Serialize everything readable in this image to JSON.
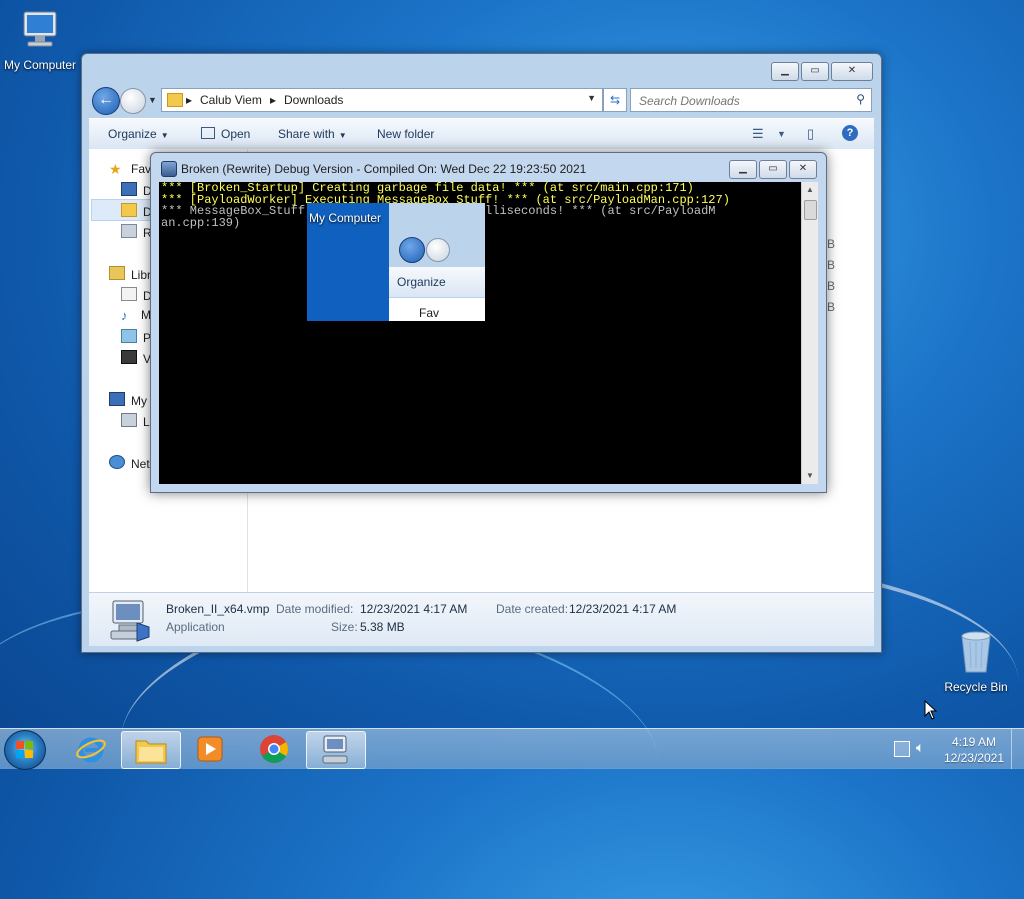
{
  "desktop": {
    "icons": [
      {
        "label": "My Computer"
      },
      {
        "label": "Recycle Bin"
      }
    ]
  },
  "explorer": {
    "address": {
      "crumbs": [
        "Calub Viem",
        "Downloads"
      ]
    },
    "search": {
      "placeholder": "Search Downloads"
    },
    "toolbar": {
      "organize": "Organize",
      "open": "Open",
      "share_with": "Share with",
      "new_folder": "New folder"
    },
    "nav": {
      "items": [
        "Fav",
        "De",
        "Do",
        "Re",
        "Libr",
        "Do",
        "M",
        "Pi",
        "Vi",
        "My",
        "Lo",
        "Net"
      ]
    },
    "size_fragments": [
      "B",
      "B",
      "B",
      "B"
    ],
    "details": {
      "filename": "Broken_II_x64.vmp",
      "type": "Application",
      "date_modified_label": "Date modified:",
      "date_modified": "12/23/2021 4:17 AM",
      "date_created_label": "Date created:",
      "date_created": "12/23/2021 4:17 AM",
      "size_label": "Size:",
      "size": "5.38 MB"
    }
  },
  "console": {
    "title": "Broken (Rewrite) Debug Version - Compiled On: Wed Dec 22 19:23:50 2021",
    "lines": [
      "*** [Broken_Startup] Creating garbage file data! *** (at src/main.cpp:171)",
      "*** [PayloadWorker] Executing MessageBox_Stuff! *** (at src/PayloadMan.cpp:127)",
      "*** MessageBox_Stuff thread s         6534 milliseconds! *** (at src/PayloadM",
      "an.cpp:139)"
    ],
    "glitch": {
      "desktop_label": "My Computer",
      "organize": "Organize",
      "fav": "Fav"
    }
  },
  "taskbar": {
    "apps": [
      "start",
      "internet-explorer",
      "windows-explorer",
      "media-player",
      "chrome",
      "broken-app"
    ],
    "active": "windows-explorer",
    "time": "4:19 AM",
    "date": "12/23/2021"
  }
}
